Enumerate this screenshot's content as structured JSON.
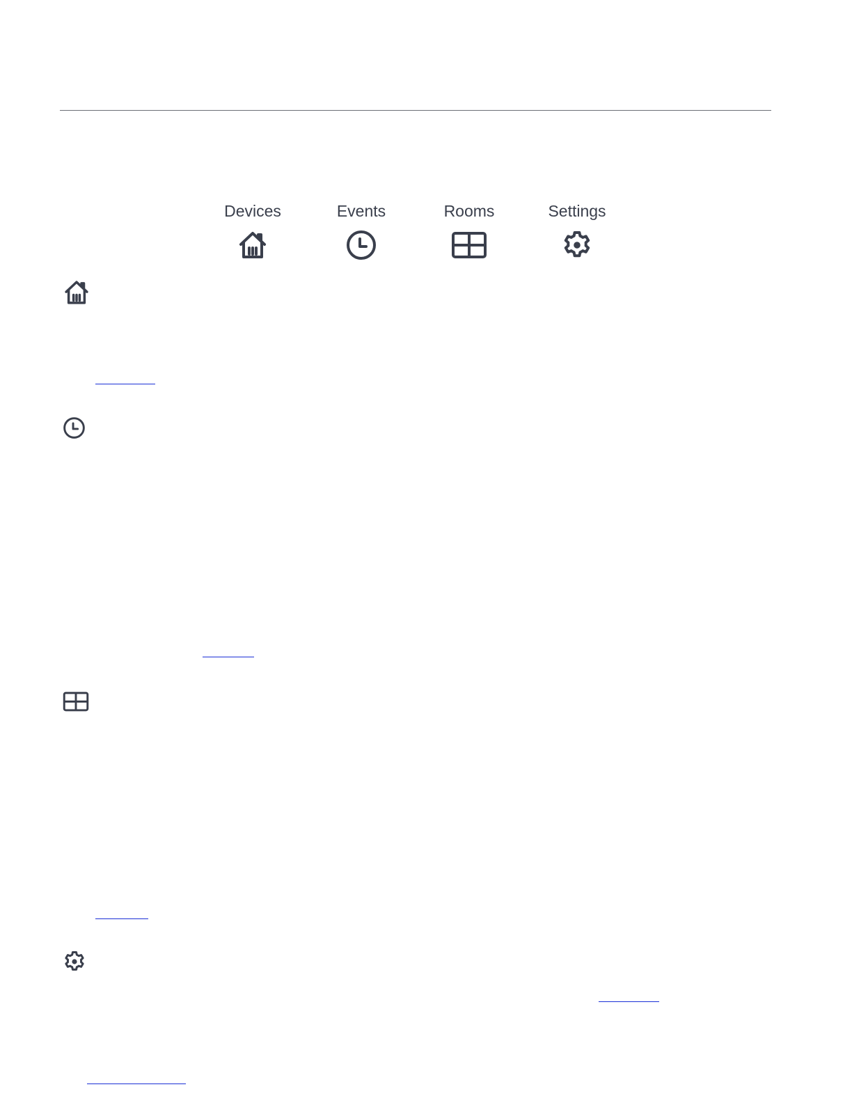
{
  "nav": {
    "items": [
      {
        "label": "Devices",
        "icon": "home-icon"
      },
      {
        "label": "Events",
        "icon": "clock-icon"
      },
      {
        "label": "Rooms",
        "icon": "grid-icon"
      },
      {
        "label": "Settings",
        "icon": "gear-icon"
      }
    ]
  },
  "sections": [
    {
      "icon": "home-icon"
    },
    {
      "icon": "clock-icon"
    },
    {
      "icon": "grid-icon"
    },
    {
      "icon": "gear-icon"
    }
  ],
  "colors": {
    "text": "#3a3f4c",
    "link": "#1a2fd6",
    "rule": "#6b6e75",
    "background": "#ffffff"
  }
}
